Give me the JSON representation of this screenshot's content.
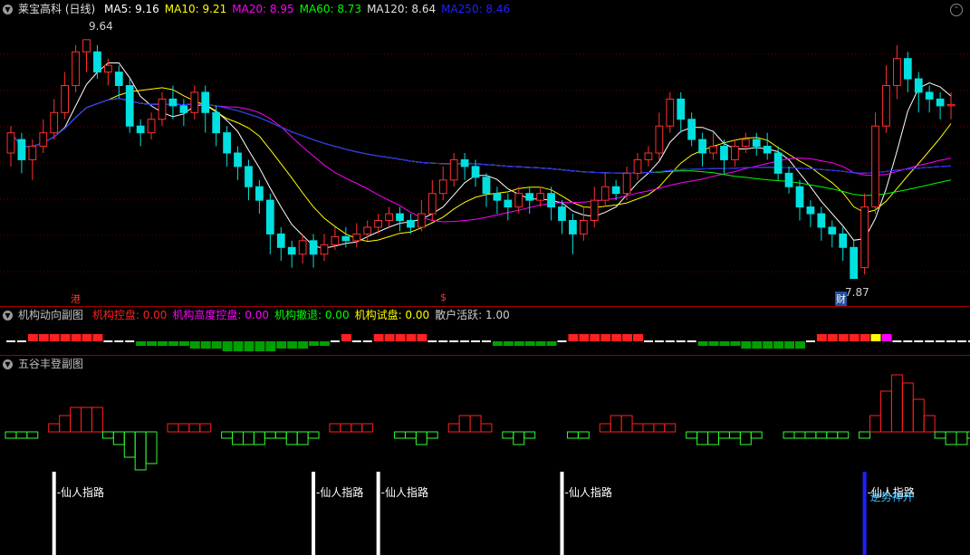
{
  "header": {
    "stock_title": "莱宝高科 (日线)",
    "ma_items": [
      {
        "label": "MA5: 9.16",
        "color": "#ffffff"
      },
      {
        "label": "MA10: 9.21",
        "color": "#ffff00"
      },
      {
        "label": "MA20: 8.95",
        "color": "#ff00ff"
      },
      {
        "label": "MA60: 8.73",
        "color": "#00ff00"
      },
      {
        "label": "MA120: 8.64",
        "color": "#e0e0e0"
      },
      {
        "label": "MA250: 8.46",
        "color": "#2020ff"
      }
    ],
    "high_label": "9.64",
    "low_label": "7.87",
    "marker_gang": "港",
    "marker_dollar": "$",
    "marker_cai": "财"
  },
  "pane2": {
    "title": "机构动向副图",
    "items": [
      {
        "label": "机构控盘: 0.00",
        "color": "#ff2020"
      },
      {
        "label": "机构高度控盘: 0.00",
        "color": "#ff00ff"
      },
      {
        "label": "机构撤退: 0.00",
        "color": "#00ff00"
      },
      {
        "label": "机构试盘: 0.00",
        "color": "#ffff00"
      },
      {
        "label": "散户活跃: 1.00",
        "color": "#d0d0d0"
      }
    ]
  },
  "pane3": {
    "title": "五谷丰登副图",
    "signals": [
      "仙人指路",
      "仙人指路",
      "仙人指路",
      "仙人指路",
      "仙人指路"
    ],
    "signal_extra": "逆势神开"
  },
  "colors": {
    "up": "#ff3030",
    "down": "#00e0e0",
    "pane_border": "#a00000"
  },
  "chart_data": {
    "type": "candlestick",
    "title": "莱宝高科 (日线)",
    "price_ylim": [
      7.8,
      9.8
    ],
    "candles": [
      [
        8.8,
        8.95,
        9.0,
        8.7
      ],
      [
        8.9,
        8.75,
        8.95,
        8.65
      ],
      [
        8.75,
        8.85,
        8.9,
        8.6
      ],
      [
        8.85,
        8.95,
        9.05,
        8.8
      ],
      [
        8.95,
        9.1,
        9.2,
        8.9
      ],
      [
        9.1,
        9.3,
        9.4,
        9.05
      ],
      [
        9.3,
        9.55,
        9.6,
        9.25
      ],
      [
        9.55,
        9.64,
        9.64,
        9.4
      ],
      [
        9.55,
        9.4,
        9.6,
        9.35
      ],
      [
        9.4,
        9.45,
        9.5,
        9.3
      ],
      [
        9.4,
        9.3,
        9.45,
        9.2
      ],
      [
        9.3,
        9.0,
        9.35,
        8.95
      ],
      [
        9.0,
        8.95,
        9.05,
        8.85
      ],
      [
        8.95,
        9.05,
        9.1,
        8.9
      ],
      [
        9.05,
        9.2,
        9.25,
        9.0
      ],
      [
        9.2,
        9.15,
        9.3,
        9.05
      ],
      [
        9.15,
        9.1,
        9.2,
        9.0
      ],
      [
        9.1,
        9.25,
        9.3,
        9.05
      ],
      [
        9.25,
        9.1,
        9.3,
        8.95
      ],
      [
        9.1,
        8.95,
        9.15,
        8.85
      ],
      [
        8.95,
        8.8,
        9.0,
        8.7
      ],
      [
        8.8,
        8.7,
        8.85,
        8.6
      ],
      [
        8.7,
        8.55,
        8.75,
        8.45
      ],
      [
        8.55,
        8.45,
        8.6,
        8.35
      ],
      [
        8.45,
        8.2,
        8.5,
        8.05
      ],
      [
        8.2,
        8.1,
        8.25,
        8.0
      ],
      [
        8.1,
        8.05,
        8.15,
        7.95
      ],
      [
        8.05,
        8.15,
        8.2,
        7.98
      ],
      [
        8.15,
        8.05,
        8.2,
        7.95
      ],
      [
        8.05,
        8.12,
        8.2,
        8.0
      ],
      [
        8.12,
        8.18,
        8.25,
        8.08
      ],
      [
        8.18,
        8.15,
        8.25,
        8.1
      ],
      [
        8.15,
        8.2,
        8.28,
        8.1
      ],
      [
        8.2,
        8.25,
        8.3,
        8.15
      ],
      [
        8.25,
        8.3,
        8.35,
        8.2
      ],
      [
        8.3,
        8.35,
        8.4,
        8.25
      ],
      [
        8.35,
        8.3,
        8.4,
        8.22
      ],
      [
        8.3,
        8.25,
        8.35,
        8.2
      ],
      [
        8.25,
        8.35,
        8.45,
        8.22
      ],
      [
        8.35,
        8.5,
        8.6,
        8.3
      ],
      [
        8.5,
        8.6,
        8.7,
        8.45
      ],
      [
        8.6,
        8.75,
        8.8,
        8.55
      ],
      [
        8.75,
        8.7,
        8.8,
        8.6
      ],
      [
        8.7,
        8.62,
        8.75,
        8.55
      ],
      [
        8.62,
        8.5,
        8.65,
        8.4
      ],
      [
        8.5,
        8.45,
        8.55,
        8.35
      ],
      [
        8.45,
        8.4,
        8.5,
        8.3
      ],
      [
        8.4,
        8.5,
        8.55,
        8.35
      ],
      [
        8.5,
        8.45,
        8.55,
        8.35
      ],
      [
        8.45,
        8.5,
        8.55,
        8.4
      ],
      [
        8.5,
        8.4,
        8.55,
        8.3
      ],
      [
        8.4,
        8.3,
        8.45,
        8.2
      ],
      [
        8.3,
        8.2,
        8.35,
        8.05
      ],
      [
        8.2,
        8.3,
        8.4,
        8.15
      ],
      [
        8.3,
        8.45,
        8.55,
        8.25
      ],
      [
        8.45,
        8.55,
        8.65,
        8.4
      ],
      [
        8.55,
        8.5,
        8.6,
        8.45
      ],
      [
        8.5,
        8.65,
        8.7,
        8.45
      ],
      [
        8.65,
        8.75,
        8.8,
        8.6
      ],
      [
        8.75,
        8.8,
        8.85,
        8.7
      ],
      [
        8.8,
        9.0,
        9.1,
        8.75
      ],
      [
        9.0,
        9.2,
        9.25,
        8.95
      ],
      [
        9.2,
        9.05,
        9.25,
        8.95
      ],
      [
        9.05,
        8.9,
        9.1,
        8.85
      ],
      [
        8.9,
        8.8,
        8.95,
        8.7
      ],
      [
        8.8,
        8.85,
        8.95,
        8.75
      ],
      [
        8.85,
        8.75,
        8.9,
        8.65
      ],
      [
        8.75,
        8.85,
        8.9,
        8.7
      ],
      [
        8.85,
        8.9,
        8.95,
        8.8
      ],
      [
        8.9,
        8.85,
        8.95,
        8.78
      ],
      [
        8.85,
        8.8,
        8.95,
        8.75
      ],
      [
        8.8,
        8.65,
        8.85,
        8.6
      ],
      [
        8.65,
        8.55,
        8.7,
        8.5
      ],
      [
        8.55,
        8.4,
        8.6,
        8.3
      ],
      [
        8.4,
        8.35,
        8.45,
        8.25
      ],
      [
        8.35,
        8.25,
        8.4,
        8.15
      ],
      [
        8.25,
        8.2,
        8.3,
        8.1
      ],
      [
        8.2,
        8.1,
        8.25,
        8.0
      ],
      [
        8.1,
        7.87,
        8.15,
        7.87
      ],
      [
        7.95,
        8.4,
        8.5,
        7.9
      ],
      [
        8.4,
        9.0,
        9.1,
        8.35
      ],
      [
        9.0,
        9.3,
        9.45,
        8.95
      ],
      [
        9.3,
        9.5,
        9.6,
        9.2
      ],
      [
        9.5,
        9.35,
        9.55,
        9.25
      ],
      [
        9.35,
        9.25,
        9.4,
        9.1
      ],
      [
        9.25,
        9.2,
        9.3,
        9.1
      ],
      [
        9.2,
        9.15,
        9.25,
        9.05
      ],
      [
        9.15,
        9.16,
        9.25,
        9.05
      ]
    ],
    "pane2_values": [
      0,
      0,
      1,
      1,
      1,
      1,
      1,
      1,
      1,
      0,
      0,
      0,
      -1,
      -1,
      -1,
      -1,
      -1,
      -2,
      -2,
      -2,
      -3,
      -3,
      -3,
      -3,
      -3,
      -2,
      -2,
      -2,
      -1,
      -1,
      0,
      1,
      0,
      0,
      1,
      1,
      1,
      1,
      1,
      0,
      0,
      0,
      0,
      0,
      0,
      -1,
      -1,
      -1,
      -1,
      -1,
      -1,
      0,
      1,
      1,
      1,
      1,
      1,
      1,
      1,
      0,
      0,
      0,
      0,
      0,
      -1,
      -1,
      -1,
      -1,
      -2,
      -2,
      -2,
      -2,
      -2,
      -2,
      0,
      1,
      1,
      1,
      1,
      1,
      1,
      1,
      0,
      0,
      0,
      0,
      0,
      0,
      0,
      0
    ],
    "pane3_values": [
      -1,
      -1,
      -1,
      0,
      1,
      2,
      3,
      3,
      3,
      -1,
      -2,
      -4,
      -6,
      -5,
      0,
      1,
      1,
      1,
      1,
      0,
      -1,
      -2,
      -2,
      -2,
      -1,
      -1,
      -2,
      -2,
      -1,
      0,
      1,
      1,
      1,
      1,
      0,
      0,
      -1,
      -1,
      -2,
      -1,
      0,
      1,
      2,
      2,
      1,
      0,
      -1,
      -2,
      -1,
      0,
      0,
      0,
      -1,
      -1,
      0,
      1,
      2,
      2,
      1,
      1,
      1,
      1,
      0,
      -1,
      -2,
      -2,
      -1,
      -1,
      -2,
      -1,
      0,
      0,
      -1,
      -1,
      -1,
      -1,
      -1,
      -1,
      0,
      -1,
      2,
      5,
      7,
      6,
      4,
      2,
      -1,
      -2,
      -2,
      -1
    ],
    "signal_positions": [
      4,
      28,
      34,
      51,
      79
    ]
  }
}
